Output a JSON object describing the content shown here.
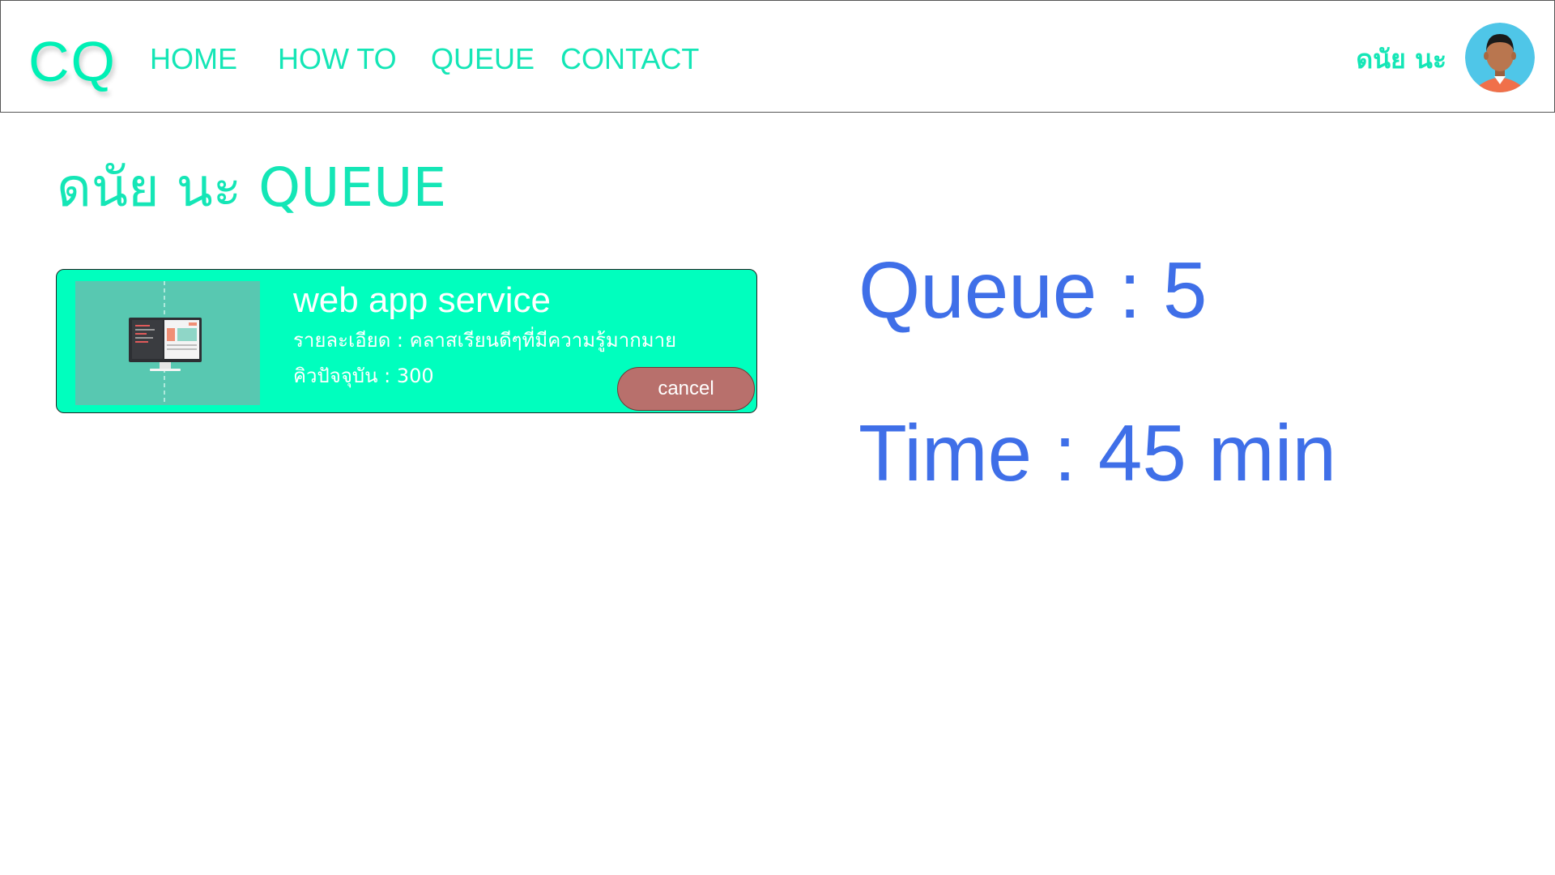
{
  "header": {
    "logo": "CQ",
    "nav": [
      {
        "label": "HOME"
      },
      {
        "label": "HOW TO"
      },
      {
        "label": "QUEUE"
      },
      {
        "label": "CONTACT"
      }
    ],
    "user_name": "ดนัย นะ",
    "avatar_icon": "user-avatar-icon"
  },
  "main": {
    "title": "ดนัย นะ QUEUE",
    "service_card": {
      "title": "web app service",
      "description": "รายละเอียด : คลาสเรียนดีๆที่มีความรู้มากมาย",
      "current_queue": "คิวปัจจุบัน : 300",
      "cancel_label": "cancel",
      "thumbnail_icon": "web-development-illustration"
    },
    "queue_text": "Queue : 5",
    "time_text": "Time : 45 min"
  },
  "colors": {
    "accent": "#00ffbe",
    "nav_text": "#14e6b6",
    "stat_text": "#3f6fe8",
    "cancel_button": "#b8706c"
  }
}
